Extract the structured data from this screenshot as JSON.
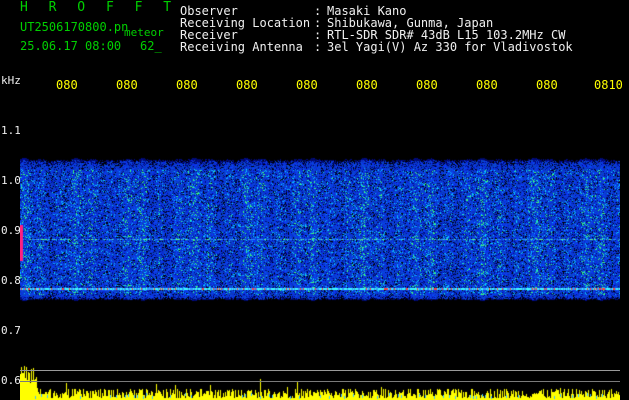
{
  "header": {
    "program": "H R O F F T",
    "file_line": "UT2506170800.pn",
    "file_suffix": "meteor",
    "datetime": "25.06.17 08:00",
    "count": "62_"
  },
  "info": {
    "rows": [
      {
        "label": "Observer",
        "value": "Masaki Kano"
      },
      {
        "label": "Receiving Location",
        "value": "Shibukawa, Gunma, Japan"
      },
      {
        "label": "Receiver",
        "value": "RTL-SDR SDR# 43dB L15 103.2MHz CW"
      },
      {
        "label": "Receiving Antenna",
        "value": "3el Yagi(V) Az 330 for Vladivostok"
      }
    ],
    "separator": ":"
  },
  "axis": {
    "unit": "kHz",
    "y_ticks": [
      "1.1",
      "1.0",
      "0.9",
      "0.8",
      "0.7",
      "0.6"
    ],
    "x_ticks": [
      "080",
      "080",
      "080",
      "080",
      "080",
      "080",
      "080",
      "080",
      "080",
      "0810"
    ]
  },
  "colors": {
    "header_green": "#00d000",
    "header_white": "#f0f0f0",
    "tick_yellow": "#ffff00",
    "background": "#000000",
    "noise_blue": "#1a3cff",
    "signal_line": "#40ffff",
    "meteor_bar": "#ffff00"
  }
}
